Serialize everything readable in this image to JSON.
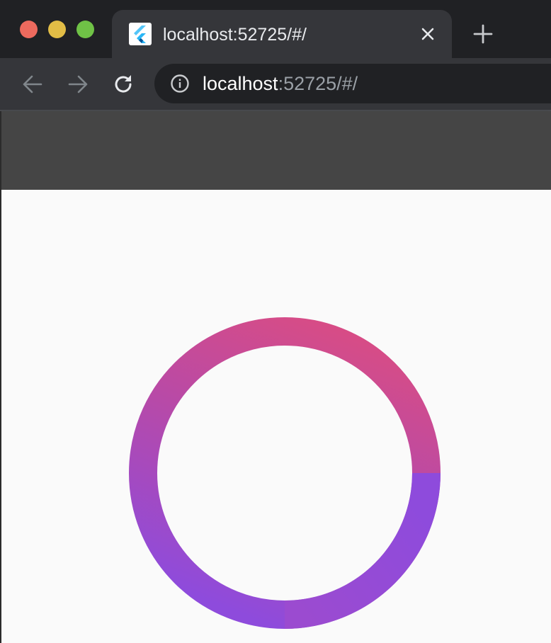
{
  "browser": {
    "tab": {
      "title": "localhost:52725/#/",
      "favicon": "flutter-icon"
    },
    "address_bar": {
      "host": "localhost",
      "rest": ":52725/#/"
    },
    "icons": {
      "back": "arrow-left-icon",
      "forward": "arrow-right-icon",
      "reload": "reload-icon",
      "info": "info-icon",
      "close_tab": "close-icon",
      "new_tab": "plus-icon"
    }
  },
  "page": {
    "appbar_color": "#454545",
    "background_color": "#fafafa",
    "ring": {
      "gradient_top_color": "#d84c85",
      "gradient_bottom_color": "#8e4bdc"
    }
  }
}
